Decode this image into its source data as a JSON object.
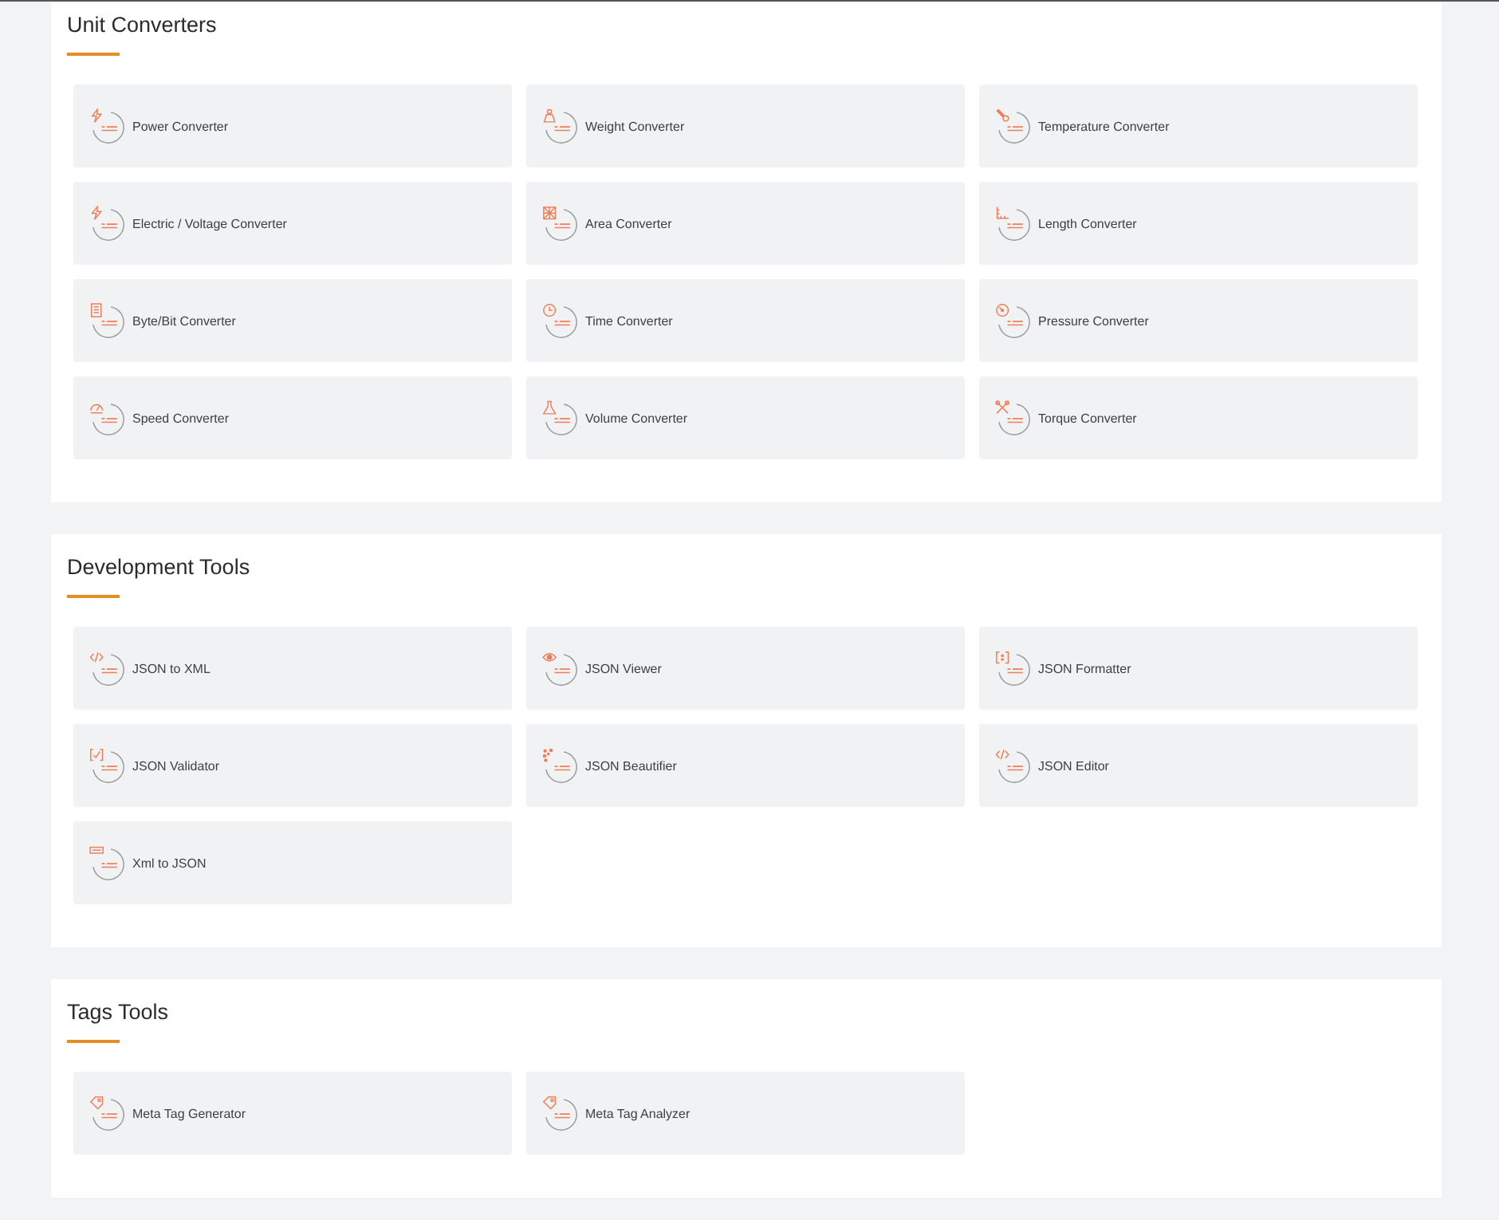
{
  "sections": [
    {
      "title": "Unit Converters",
      "tools": [
        {
          "label": "Power Converter"
        },
        {
          "label": "Weight Converter"
        },
        {
          "label": "Temperature Converter"
        },
        {
          "label": "Electric / Voltage Converter"
        },
        {
          "label": "Area Converter"
        },
        {
          "label": "Length Converter"
        },
        {
          "label": "Byte/Bit Converter"
        },
        {
          "label": "Time Converter"
        },
        {
          "label": "Pressure Converter"
        },
        {
          "label": "Speed Converter"
        },
        {
          "label": "Volume Converter"
        },
        {
          "label": "Torque Converter"
        }
      ]
    },
    {
      "title": "Development Tools",
      "tools": [
        {
          "label": "JSON to XML"
        },
        {
          "label": "JSON Viewer"
        },
        {
          "label": "JSON Formatter"
        },
        {
          "label": "JSON Validator"
        },
        {
          "label": "JSON Beautifier"
        },
        {
          "label": "JSON Editor"
        },
        {
          "label": "Xml to JSON"
        }
      ]
    },
    {
      "title": "Tags Tools",
      "tools": [
        {
          "label": "Meta Tag Generator"
        },
        {
          "label": "Meta Tag Analyzer"
        }
      ]
    }
  ]
}
